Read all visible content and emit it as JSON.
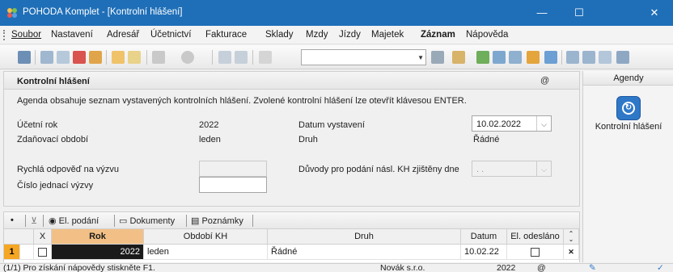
{
  "window": {
    "title": "POHODA Komplet - [Kontrolní hlášení]",
    "minimize_glyph": "—",
    "maximize_glyph": "☐",
    "close_glyph": "✕"
  },
  "menu": [
    "Soubor",
    "Nastavení",
    "Adresář",
    "Účetnictví",
    "Fakturace",
    "Sklady",
    "Mzdy",
    "Jízdy",
    "Majetek",
    "Záznam",
    "Nápověda"
  ],
  "toolbar": {
    "icons": [
      "report-icon",
      "print-icon",
      "print-preview-icon",
      "pdf-icon",
      "export-icon",
      "new-record-icon",
      "check-icon",
      "back-icon",
      "record-icon",
      "save-icon",
      "save-all-icon",
      "copy-icon",
      "filter-icon",
      "note-icon",
      "tag-icon",
      "calculator-icon",
      "calendar-icon",
      "people-icon",
      "bank-icon",
      "window-icon",
      "window2-icon",
      "help-icon"
    ],
    "combo_value": ""
  },
  "panel": {
    "title": "Kontrolní hlášení",
    "at_symbol": "@",
    "description": "Agenda obsahuje seznam vystavených kontrolních hlášení. Zvolené kontrolní hlášení lze otevřít klávesou ENTER.",
    "fields": {
      "ucetni_rok_label": "Účetní rok",
      "ucetni_rok_value": "2022",
      "zdanovaci_obdobi_label": "Zdaňovací období",
      "zdanovaci_obdobi_value": "leden",
      "datum_vystaveni_label": "Datum vystavení",
      "datum_vystaveni_value": "10.02.2022",
      "druh_label": "Druh",
      "druh_value": "Řádné",
      "rychla_odpoved_label": "Rychlá odpověď na výzvu",
      "rychla_odpoved_value": "",
      "cislo_jednaci_label": "Číslo jednací výzvy",
      "cislo_jednaci_value": "",
      "duvody_label": "Důvody pro podání násl. KH zjištěny dne",
      "duvody_value": ". ."
    }
  },
  "tabs": {
    "star": "•",
    "items": [
      "El. podání",
      "Dokumenty",
      "Poznámky"
    ]
  },
  "grid": {
    "columns": [
      "",
      "X",
      "Rok",
      "Období KH",
      "Druh",
      "Datum",
      "El. odesláno"
    ],
    "rows": [
      {
        "index": "1",
        "rok": "2022",
        "obdobi": "leden",
        "druh": "Řádné",
        "datum": "10.02.22"
      }
    ]
  },
  "agendy": {
    "header": "Agendy",
    "item_label": "Kontrolní hlášení"
  },
  "status": {
    "help": "(1/1) Pro získání nápovědy stiskněte F1.",
    "company": "Novák s.r.o.",
    "year": "2022",
    "at_symbol": "@"
  },
  "colors": {
    "titlebar": "#1f6fb8",
    "selected_header": "#f2c086",
    "selected_row": "#1a1a1a",
    "row_index": "#f5a623"
  }
}
